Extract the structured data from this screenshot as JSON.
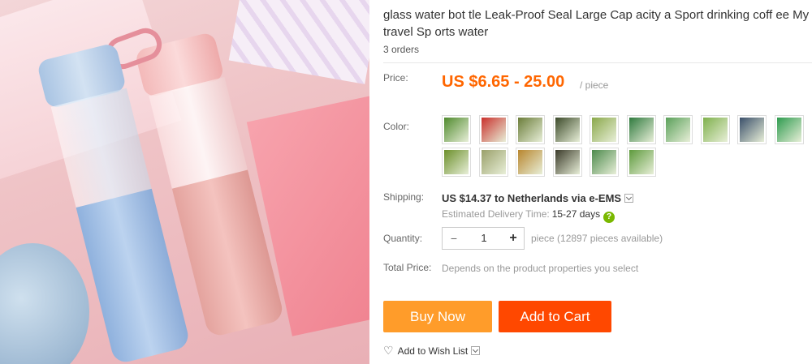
{
  "product": {
    "title": "glass water bot tle Leak-Proof Seal Large Cap acity a Sport drinking coff ee My travel Sp orts water",
    "orders": "3 orders"
  },
  "price": {
    "label": "Price:",
    "value": "US $6.65 - 25.00",
    "unit": "/ piece"
  },
  "color": {
    "label": "Color:",
    "swatches": [
      {
        "name": "swatch-1",
        "color": "#4f8a2d"
      },
      {
        "name": "swatch-2",
        "color": "#c9302c"
      },
      {
        "name": "swatch-3",
        "color": "#6b7d3a"
      },
      {
        "name": "swatch-4",
        "color": "#3c4a2a"
      },
      {
        "name": "swatch-5",
        "color": "#8aa84a"
      },
      {
        "name": "swatch-6",
        "color": "#2f7a3e"
      },
      {
        "name": "swatch-7",
        "color": "#5aa05a"
      },
      {
        "name": "swatch-8",
        "color": "#7fb04c"
      },
      {
        "name": "swatch-9",
        "color": "#3a4f6a"
      },
      {
        "name": "swatch-10",
        "color": "#2e9b4f"
      },
      {
        "name": "swatch-11",
        "color": "#6b8f2a"
      },
      {
        "name": "swatch-12",
        "color": "#9aa06a"
      },
      {
        "name": "swatch-13",
        "color": "#b8862e"
      },
      {
        "name": "swatch-14",
        "color": "#3b3b2a"
      },
      {
        "name": "swatch-15",
        "color": "#4c8a4c"
      },
      {
        "name": "swatch-16",
        "color": "#5d9a3c"
      }
    ]
  },
  "shipping": {
    "label": "Shipping:",
    "value": "US $14.37 to Netherlands via e-EMS",
    "delivery_label": "Estimated Delivery Time:",
    "delivery_value": "15-27 days",
    "help_icon": "?"
  },
  "quantity": {
    "label": "Quantity:",
    "minus": "−",
    "value": "1",
    "plus": "+",
    "availability": "piece (12897 pieces available)"
  },
  "total": {
    "label": "Total Price:",
    "value": "Depends on the product properties you select"
  },
  "actions": {
    "buy_now": "Buy Now",
    "add_to_cart": "Add to Cart",
    "wish_list": "Add to Wish List"
  }
}
